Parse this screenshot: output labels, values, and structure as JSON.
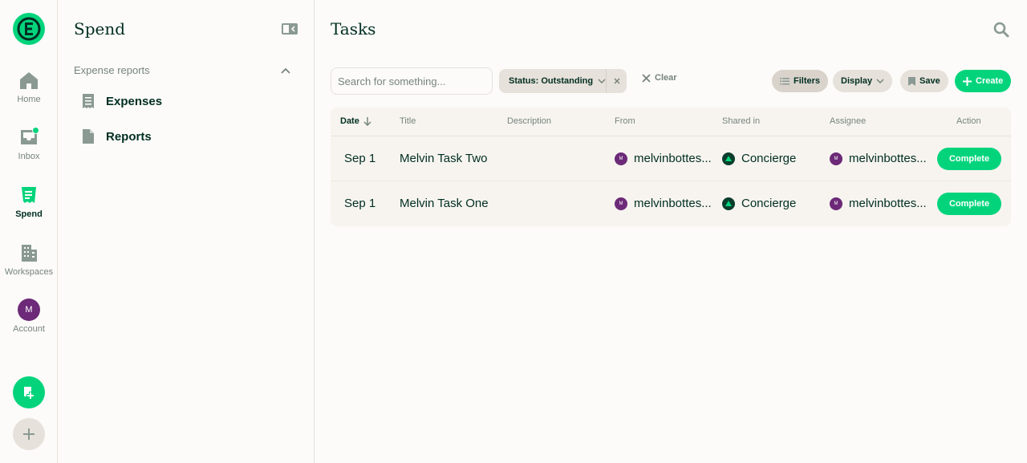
{
  "rail": {
    "items": [
      {
        "label": "Home",
        "icon": "home-icon"
      },
      {
        "label": "Inbox",
        "icon": "inbox-icon"
      },
      {
        "label": "Spend",
        "icon": "receipt-icon"
      },
      {
        "label": "Workspaces",
        "icon": "building-icon"
      },
      {
        "label": "Account",
        "icon": "avatar"
      }
    ],
    "avatar_initial": "M"
  },
  "sidebar": {
    "title": "Spend",
    "section": "Expense reports",
    "items": [
      {
        "label": "Expenses",
        "icon": "receipt-list-icon"
      },
      {
        "label": "Reports",
        "icon": "document-icon"
      }
    ]
  },
  "main": {
    "title": "Tasks",
    "search_placeholder": "Search for something...",
    "filter_chip": "Status: Outstanding",
    "clear_label": "Clear",
    "filters_label": "Filters",
    "display_label": "Display",
    "save_label": "Save",
    "create_label": "Create"
  },
  "table": {
    "columns": [
      "Date",
      "Title",
      "Description",
      "From",
      "Shared in",
      "Assignee",
      "Action"
    ],
    "rows": [
      {
        "date": "Sep 1",
        "title": "Melvin Task Two",
        "description": "",
        "from": "melvinbottes...",
        "from_initial": "M",
        "shared_in": "Concierge",
        "assignee": "melvinbottes...",
        "assignee_initial": "M",
        "action": "Complete"
      },
      {
        "date": "Sep 1",
        "title": "Melvin Task One",
        "description": "",
        "from": "melvinbottes...",
        "from_initial": "M",
        "shared_in": "Concierge",
        "assignee": "melvinbottes...",
        "assignee_initial": "M",
        "action": "Complete"
      }
    ]
  },
  "colors": {
    "accent": "#03d47c",
    "text": "#002e22",
    "muted": "#76847e",
    "avatar": "#6c2a78"
  }
}
